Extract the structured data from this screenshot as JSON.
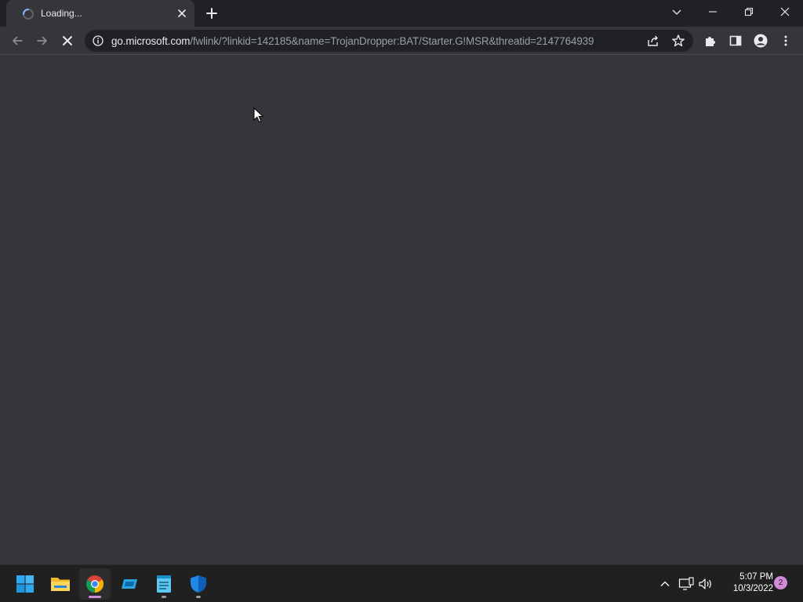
{
  "tab": {
    "title": "Loading..."
  },
  "omnibox": {
    "host": "go.microsoft.com",
    "path": "/fwlink/?linkid=142185&name=TrojanDropper:BAT/Starter.G!MSR&threatid=2147764939"
  },
  "taskbar": {
    "apps": [
      "start-icon",
      "file-explorer-icon",
      "chrome-icon",
      "cloud-drive-icon",
      "notepad-icon",
      "windows-security-icon"
    ],
    "clock_time": "5:07 PM",
    "clock_date": "10/3/2022",
    "notification_count": "2"
  },
  "colors": {
    "page_bg": "#35363a",
    "tabstrip_bg": "#202124",
    "taskbar_bg": "#202020",
    "accent": "#d38ad9"
  }
}
